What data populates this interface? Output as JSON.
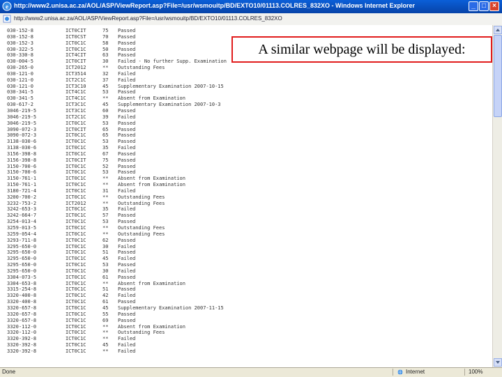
{
  "window": {
    "title": "http://www2.unisa.ac.za/AOL/ASP/ViewReport.asp?File=/usr/wsmouitp/BD/EXTO10/01113.COLRES_832XO - Windows Internet Explorer",
    "address": "http://www2.unisa.ac.za/AOL/ASP/ViewReport.asp?File=/usr/wsmouitp/BD/EXTO10/01113.COLRES_832XO"
  },
  "callout": {
    "text": "A similar webpage will be displayed:",
    "border_color": "#e11c1c"
  },
  "report": {
    "rows": [
      {
        "student": "030-152-8",
        "module": "ICT0CIT",
        "mark": "75",
        "result": "Passed"
      },
      {
        "student": "030-152-8",
        "module": "ICT0CST",
        "mark": "70",
        "result": "Passed"
      },
      {
        "student": "030-152-3",
        "module": "ICT0C1C",
        "mark": "58",
        "result": "Passed"
      },
      {
        "student": "030-322-5",
        "module": "ICT0C1C",
        "mark": "50",
        "result": "Passed"
      },
      {
        "student": "030-330-8",
        "module": "ICT4CIT",
        "mark": "63",
        "result": "Passed"
      },
      {
        "student": "030-004-5",
        "module": "ICT0CIT",
        "mark": "30",
        "result": "Failed - No further Supp. Examination"
      },
      {
        "student": "030-265-0",
        "module": "ICT2012",
        "mark": "**",
        "result": "Outstanding Fees"
      },
      {
        "student": "030-121-0",
        "module": "ICT3514",
        "mark": "32",
        "result": "Failed"
      },
      {
        "student": "030-121-0",
        "module": "ICT2C1C",
        "mark": "37",
        "result": "Failed"
      },
      {
        "student": "030-121-0",
        "module": "ICT3C10",
        "mark": "45",
        "result": "Supplementary Examination 2007-10-15"
      },
      {
        "student": "030-341-5",
        "module": "ICT4C1C",
        "mark": "53",
        "result": "Passed"
      },
      {
        "student": "030-341-5",
        "module": "ICT4C1C",
        "mark": "**",
        "result": "Absent from Examination"
      },
      {
        "student": "030-617-2",
        "module": "ICT3C1C",
        "mark": "45",
        "result": "Supplementary Examination 2007-10-3"
      },
      {
        "student": "3046-219-5",
        "module": "ICT3C1C",
        "mark": "60",
        "result": "Passed"
      },
      {
        "student": "3046-219-5",
        "module": "ICT2C1C",
        "mark": "39",
        "result": "Failed"
      },
      {
        "student": "3046-219-5",
        "module": "ICT0C1C",
        "mark": "53",
        "result": "Passed"
      },
      {
        "student": "3090-072-3",
        "module": "ICT0CIT",
        "mark": "65",
        "result": "Passed"
      },
      {
        "student": "3090-072-3",
        "module": "ICT0C1C",
        "mark": "65",
        "result": "Passed"
      },
      {
        "student": "3138-030-6",
        "module": "ICT0C1C",
        "mark": "53",
        "result": "Passed"
      },
      {
        "student": "3138-030-6",
        "module": "ICT0C1C",
        "mark": "35",
        "result": "Failed"
      },
      {
        "student": "3156-398-8",
        "module": "ICT0C1C",
        "mark": "67",
        "result": "Passed"
      },
      {
        "student": "3156-398-8",
        "module": "ICT0CIT",
        "mark": "75",
        "result": "Passed"
      },
      {
        "student": "3150-700-6",
        "module": "ICT0C1C",
        "mark": "52",
        "result": "Passed"
      },
      {
        "student": "3150-700-6",
        "module": "ICT0C1C",
        "mark": "53",
        "result": "Passed"
      },
      {
        "student": "3150-761-1",
        "module": "ICT0C1C",
        "mark": "**",
        "result": "Absent from Examination"
      },
      {
        "student": "3150-761-1",
        "module": "ICT0C1C",
        "mark": "**",
        "result": "Absent from Examination"
      },
      {
        "student": "3180-721-4",
        "module": "ICT0C1C",
        "mark": "31",
        "result": "Failed"
      },
      {
        "student": "3200-700-2",
        "module": "ICT0C1C",
        "mark": "**",
        "result": "Outstanding Fees"
      },
      {
        "student": "3232-753-2",
        "module": "ICT2012",
        "mark": "**",
        "result": "Outstanding Fees"
      },
      {
        "student": "3242-653-3",
        "module": "ICT0C1C",
        "mark": "35",
        "result": "Failed"
      },
      {
        "student": "3242-664-7",
        "module": "ICT0C1C",
        "mark": "57",
        "result": "Passed"
      },
      {
        "student": "3254-013-4",
        "module": "ICT0C1C",
        "mark": "53",
        "result": "Passed"
      },
      {
        "student": "3259-013-5",
        "module": "ICT0C1C",
        "mark": "**",
        "result": "Outstanding Fees"
      },
      {
        "student": "3259-054-4",
        "module": "ICT0C1C",
        "mark": "**",
        "result": "Outstanding Fees"
      },
      {
        "student": "3293-711-8",
        "module": "ICT0C1C",
        "mark": "62",
        "result": "Passed"
      },
      {
        "student": "3295-650-0",
        "module": "ICT0C1C",
        "mark": "30",
        "result": "Failed"
      },
      {
        "student": "3295-650-0",
        "module": "ICT0C1C",
        "mark": "51",
        "result": "Passed"
      },
      {
        "student": "3295-650-0",
        "module": "ICT0C1C",
        "mark": "45",
        "result": "Failed"
      },
      {
        "student": "3295-650-0",
        "module": "ICT0C1C",
        "mark": "53",
        "result": "Passed"
      },
      {
        "student": "3295-650-0",
        "module": "ICT0C1C",
        "mark": "30",
        "result": "Failed"
      },
      {
        "student": "3304-073-5",
        "module": "ICT0C1C",
        "mark": "61",
        "result": "Passed"
      },
      {
        "student": "3304-653-8",
        "module": "ICT0C1C",
        "mark": "**",
        "result": "Absent from Examination"
      },
      {
        "student": "3315-254-8",
        "module": "ICT0C1C",
        "mark": "51",
        "result": "Passed"
      },
      {
        "student": "3320-400-8",
        "module": "ICT0C1C",
        "mark": "42",
        "result": "Failed"
      },
      {
        "student": "3320-400-8",
        "module": "ICT0C1C",
        "mark": "61",
        "result": "Passed"
      },
      {
        "student": "3320-657-8",
        "module": "ICT0C1C",
        "mark": "45",
        "result": "Supplementary Examination 2007-11-15"
      },
      {
        "student": "3320-657-8",
        "module": "ICT0C1C",
        "mark": "55",
        "result": "Passed"
      },
      {
        "student": "3320-657-8",
        "module": "ICT0C1C",
        "mark": "69",
        "result": "Passed"
      },
      {
        "student": "3320-112-0",
        "module": "ICT0C1C",
        "mark": "**",
        "result": "Absent from Examination"
      },
      {
        "student": "3320-112-0",
        "module": "ICT0C1C",
        "mark": "**",
        "result": "Outstanding Fees"
      },
      {
        "student": "3320-392-8",
        "module": "ICT0C1C",
        "mark": "**",
        "result": "Failed"
      },
      {
        "student": "3320-392-8",
        "module": "ICT0C1C",
        "mark": "45",
        "result": "Failed"
      },
      {
        "student": "3320-392-8",
        "module": "ICT0C1C",
        "mark": "**",
        "result": "Failed"
      }
    ]
  },
  "statusbar": {
    "status": "Done",
    "zone": "Internet",
    "zoom": "100%"
  }
}
